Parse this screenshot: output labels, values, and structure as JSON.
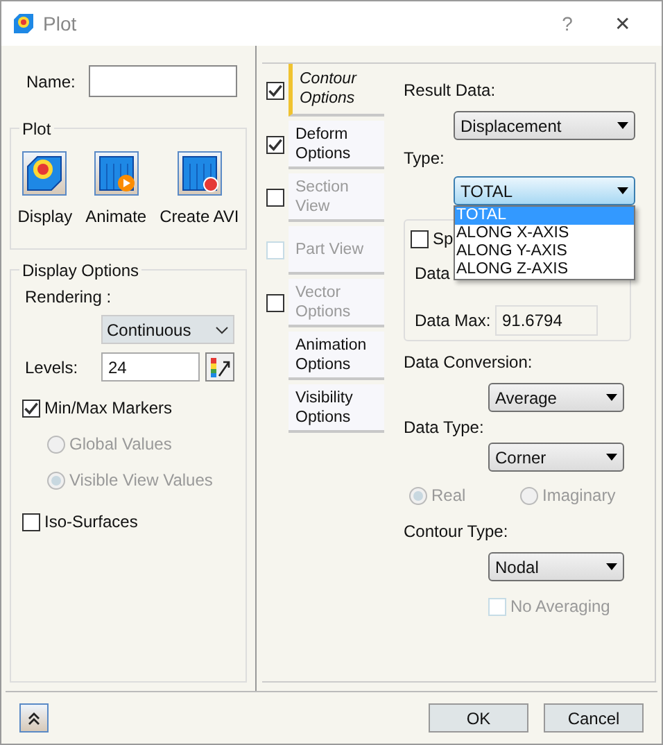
{
  "window": {
    "title": "Plot",
    "help": "?",
    "close": "✕"
  },
  "name_field": {
    "label": "Name:"
  },
  "plot_group": {
    "title": "Plot",
    "buttons": [
      {
        "kind": "display",
        "label": "Display"
      },
      {
        "kind": "animate",
        "label": "Animate"
      },
      {
        "kind": "avi",
        "label": "Create AVI"
      }
    ]
  },
  "display_options": {
    "title": "Display Options",
    "rendering_label": "Rendering :",
    "rendering": "Continuous",
    "levels_label": "Levels:",
    "levels": "24",
    "min_max": {
      "label": "Min/Max Markers",
      "checked": true
    },
    "radios": [
      {
        "label": "Global Values",
        "selected": false,
        "disabled": true
      },
      {
        "label": "Visible View Values",
        "selected": true,
        "disabled": true
      }
    ],
    "iso_surfaces": {
      "label": "Iso-Surfaces",
      "checked": false
    }
  },
  "tabs": [
    {
      "label": "Contour Options",
      "selected": true,
      "disabled": false,
      "checkbox": {
        "checked": true,
        "disabled": false
      }
    },
    {
      "label": "Deform Options",
      "selected": false,
      "disabled": false,
      "checkbox": {
        "checked": true,
        "disabled": false
      }
    },
    {
      "label": "Section View",
      "selected": false,
      "disabled": true,
      "checkbox": {
        "checked": false,
        "disabled": false
      }
    },
    {
      "label": "Part View",
      "selected": false,
      "disabled": true,
      "checkbox": {
        "checked": false,
        "disabled": true
      }
    },
    {
      "label": "Vector Options",
      "selected": false,
      "disabled": true,
      "checkbox": {
        "checked": false,
        "disabled": false
      }
    },
    {
      "label": "Animation Options",
      "selected": false,
      "disabled": false
    },
    {
      "label": "Visibility Options",
      "selected": false,
      "disabled": false
    }
  ],
  "contour": {
    "result_data_label": "Result Data:",
    "result_data": "Displacement",
    "type_label": "Type:",
    "type": "TOTAL",
    "type_options": [
      {
        "label": "TOTAL",
        "selected": true
      },
      {
        "label": "ALONG X-AXIS",
        "selected": false
      },
      {
        "label": "ALONG Y-AXIS",
        "selected": false
      },
      {
        "label": "ALONG Z-AXIS",
        "selected": false
      }
    ],
    "specify_checkbox": {
      "label": "Sp",
      "checked": false
    },
    "data_min_label": "Data",
    "data_max_label": "Data Max:",
    "data_max": "91.6794",
    "conversion_label": "Data Conversion:",
    "conversion": "Average",
    "data_type_label": "Data Type:",
    "data_type": "Corner",
    "radios": [
      {
        "label": "Real",
        "selected": true
      },
      {
        "label": "Imaginary",
        "selected": false
      }
    ],
    "contour_type_label": "Contour Type:",
    "contour_type": "Nodal",
    "no_averaging": {
      "label": "No Averaging",
      "checked": false,
      "disabled": true
    }
  },
  "buttons": [
    {
      "label": "OK"
    },
    {
      "label": "Cancel"
    }
  ]
}
